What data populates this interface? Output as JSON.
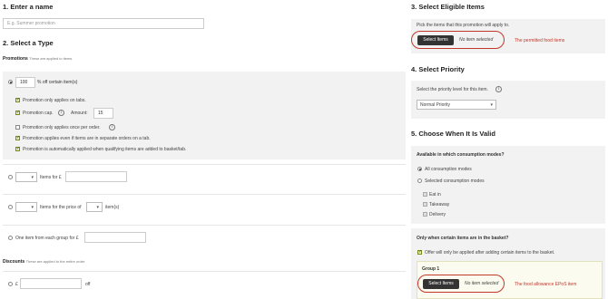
{
  "sections": {
    "enter_name": "1. Enter a name",
    "select_type": "2. Select a Type",
    "eligible_items": "3. Select Eligible Items",
    "priority": "4. Select Priority",
    "when_valid": "5. Choose When It Is Valid"
  },
  "name_field": {
    "placeholder": "E.g. Summer promotion"
  },
  "promotions": {
    "heading": "Promotions",
    "sub": "These are applied to items",
    "percent_value": "100",
    "percent_label": "% off certain item(s)",
    "options": [
      {
        "label": "Promotion only applies on tabs.",
        "checked": true
      },
      {
        "label": "Promotion cap.",
        "checked": true
      },
      {
        "label": "Promotion only applies once per order.",
        "checked": false
      },
      {
        "label": "Promotion applies even if items are in separate orders on a tab.",
        "checked": true
      },
      {
        "label": "Promotion is automatically applied when qualifying items are added to basket/tab.",
        "checked": true
      }
    ],
    "amount_label": "Amount:",
    "amount_value": "15",
    "items_for_label": "Items for £",
    "items_price_label": "Items for the price of",
    "items_suffix": "item(s)",
    "group_label": "One item from each group for £"
  },
  "discounts": {
    "heading": "Discounts",
    "sub": "These are applied to the entire order.",
    "currency": "£",
    "off_label": "off"
  },
  "eligible": {
    "intro": "Pick the items that this promotion will apply to.",
    "button": "Select Items",
    "status": "No item selected",
    "annotation": "The permitted food items"
  },
  "priority": {
    "intro": "Select the priority level for this item.",
    "selected": "Normal Priority"
  },
  "consumption": {
    "question": "Available in which consumption modes?",
    "all_label": "All consumption modes",
    "selected_label": "Selected consumption modes",
    "modes": [
      "Eat in",
      "Takeaway",
      "Delivery"
    ]
  },
  "basket": {
    "question": "Only when certain items are in the basket?",
    "offer_label": "Offer will only be applied after adding certain items to the basket.",
    "group_title": "Group 1",
    "button": "Select Items",
    "status": "No item selected",
    "annotation": "The food allowance EPoS item"
  },
  "icons": {
    "info": "i",
    "chevron": "▾"
  }
}
